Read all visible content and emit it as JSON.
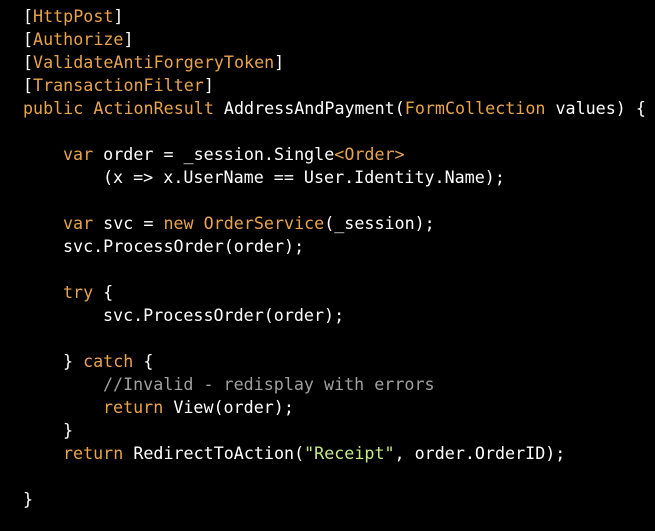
{
  "code_view": {
    "colors": {
      "background": "#000000",
      "default_text": "#ffffff",
      "keyword": "#e8a44a",
      "type": "#e8a44a",
      "string": "#c4e88a",
      "comment": "#a0a0a0",
      "punctuation": "#ffffff"
    },
    "lines": [
      {
        "indent": 0,
        "tokens": [
          {
            "t": "[",
            "c": "default_text"
          },
          {
            "t": "HttpPost",
            "c": "type"
          },
          {
            "t": "]",
            "c": "default_text"
          }
        ]
      },
      {
        "indent": 0,
        "tokens": [
          {
            "t": "[",
            "c": "default_text"
          },
          {
            "t": "Authorize",
            "c": "type"
          },
          {
            "t": "]",
            "c": "default_text"
          }
        ]
      },
      {
        "indent": 0,
        "tokens": [
          {
            "t": "[",
            "c": "default_text"
          },
          {
            "t": "ValidateAntiForgeryToken",
            "c": "type"
          },
          {
            "t": "]",
            "c": "default_text"
          }
        ]
      },
      {
        "indent": 0,
        "tokens": [
          {
            "t": "[",
            "c": "default_text"
          },
          {
            "t": "TransactionFilter",
            "c": "type"
          },
          {
            "t": "]",
            "c": "default_text"
          }
        ]
      },
      {
        "indent": 0,
        "tokens": [
          {
            "t": "public",
            "c": "keyword"
          },
          {
            "t": " ",
            "c": "default_text"
          },
          {
            "t": "ActionResult",
            "c": "type"
          },
          {
            "t": " AddressAndPayment(",
            "c": "default_text"
          },
          {
            "t": "FormCollection",
            "c": "type"
          },
          {
            "t": " values) {",
            "c": "default_text"
          }
        ]
      },
      {
        "indent": 0,
        "tokens": []
      },
      {
        "indent": 1,
        "tokens": [
          {
            "t": "var",
            "c": "keyword"
          },
          {
            "t": " order = _session.Single",
            "c": "default_text"
          },
          {
            "t": "<",
            "c": "keyword"
          },
          {
            "t": "Order",
            "c": "type"
          },
          {
            "t": ">",
            "c": "keyword"
          }
        ]
      },
      {
        "indent": 2,
        "tokens": [
          {
            "t": "(x => x.UserName == User.Identity.Name);",
            "c": "default_text"
          }
        ]
      },
      {
        "indent": 0,
        "tokens": []
      },
      {
        "indent": 1,
        "tokens": [
          {
            "t": "var",
            "c": "keyword"
          },
          {
            "t": " svc = ",
            "c": "default_text"
          },
          {
            "t": "new",
            "c": "keyword"
          },
          {
            "t": " ",
            "c": "default_text"
          },
          {
            "t": "OrderService",
            "c": "type"
          },
          {
            "t": "(_session);",
            "c": "default_text"
          }
        ]
      },
      {
        "indent": 1,
        "tokens": [
          {
            "t": "svc.ProcessOrder(order);",
            "c": "default_text"
          }
        ]
      },
      {
        "indent": 0,
        "tokens": []
      },
      {
        "indent": 1,
        "tokens": [
          {
            "t": "try",
            "c": "keyword"
          },
          {
            "t": " {",
            "c": "default_text"
          }
        ]
      },
      {
        "indent": 2,
        "tokens": [
          {
            "t": "svc.ProcessOrder(order);",
            "c": "default_text"
          }
        ]
      },
      {
        "indent": 0,
        "tokens": []
      },
      {
        "indent": 1,
        "tokens": [
          {
            "t": "} ",
            "c": "default_text"
          },
          {
            "t": "catch",
            "c": "keyword"
          },
          {
            "t": " {",
            "c": "default_text"
          }
        ]
      },
      {
        "indent": 2,
        "tokens": [
          {
            "t": "//Invalid - redisplay with errors",
            "c": "comment"
          }
        ]
      },
      {
        "indent": 2,
        "tokens": [
          {
            "t": "return",
            "c": "keyword"
          },
          {
            "t": " View(order);",
            "c": "default_text"
          }
        ]
      },
      {
        "indent": 1,
        "tokens": [
          {
            "t": "}",
            "c": "default_text"
          }
        ]
      },
      {
        "indent": 1,
        "tokens": [
          {
            "t": "return",
            "c": "keyword"
          },
          {
            "t": " RedirectToAction(",
            "c": "default_text"
          },
          {
            "t": "\"Receipt\"",
            "c": "string"
          },
          {
            "t": ", order.OrderID);",
            "c": "default_text"
          }
        ]
      },
      {
        "indent": 0,
        "tokens": []
      },
      {
        "indent": 0,
        "tokens": [
          {
            "t": "}",
            "c": "default_text"
          }
        ]
      }
    ]
  }
}
